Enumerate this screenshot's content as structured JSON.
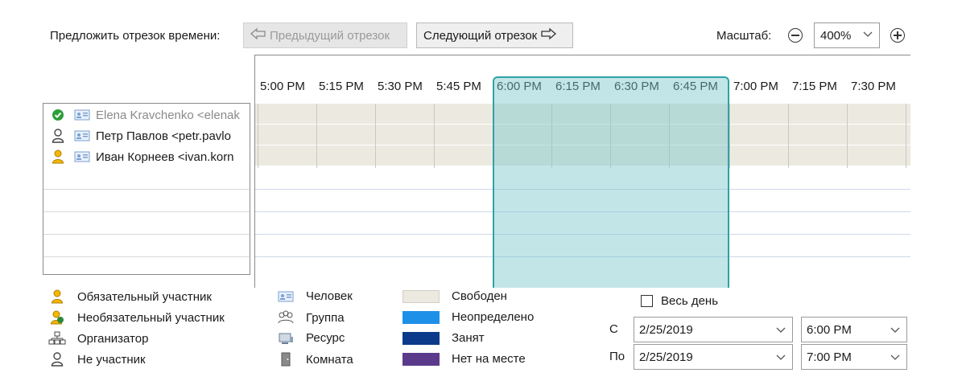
{
  "toolbar": {
    "suggest_label": "Предложить отрезок времени:",
    "prev_label": "Предыдущий отрезок",
    "next_label": "Следующий отрезок",
    "scale_label": "Масштаб:",
    "zoom_value": "400%"
  },
  "attendees": [
    {
      "role_icon": "check-circle-icon",
      "type_icon": "person-card-icon",
      "name": "Elena Kravchenko <elenak"
    },
    {
      "role_icon": "not-attendee-icon",
      "type_icon": "person-card-icon",
      "name": "Петр Павлов <petr.pavlo"
    },
    {
      "role_icon": "required-attendee-icon",
      "type_icon": "person-card-icon",
      "name": "Иван Корнеев <ivan.korn"
    }
  ],
  "timeline": {
    "times": [
      "5:00 PM",
      "5:15 PM",
      "5:30 PM",
      "5:45 PM",
      "6:00 PM",
      "6:15 PM",
      "6:30 PM",
      "6:45 PM",
      "7:00 PM",
      "7:15 PM",
      "7:30 PM"
    ],
    "selection_start": "6:00 PM",
    "selection_end": "7:00 PM",
    "free_color": "#eceae0",
    "selection_color": "#7fcfd2"
  },
  "legend": {
    "roles": [
      {
        "icon": "required-attendee-icon",
        "label": "Обязательный участник"
      },
      {
        "icon": "optional-attendee-icon",
        "label": "Необязательный участник"
      },
      {
        "icon": "organizer-icon",
        "label": "Организатор"
      },
      {
        "icon": "not-attendee-icon",
        "label": "Не участник"
      }
    ],
    "types": [
      {
        "icon": "person-card-icon",
        "label": "Человек"
      },
      {
        "icon": "group-icon",
        "label": "Группа"
      },
      {
        "icon": "resource-icon",
        "label": "Ресурс"
      },
      {
        "icon": "room-icon",
        "label": "Комната"
      }
    ],
    "statuses": [
      {
        "label": "Свободен",
        "color": "#eceae0"
      },
      {
        "label": "Неопределено",
        "color": "#1e90e8"
      },
      {
        "label": "Занят",
        "color": "#0b3a8a"
      },
      {
        "label": "Нет на месте",
        "color": "#5b3a8c"
      }
    ]
  },
  "datetime": {
    "all_day_label": "Весь день",
    "from_label": "С",
    "to_label": "По",
    "from_date": "2/25/2019",
    "from_time": "6:00 PM",
    "to_date": "2/25/2019",
    "to_time": "7:00 PM"
  }
}
